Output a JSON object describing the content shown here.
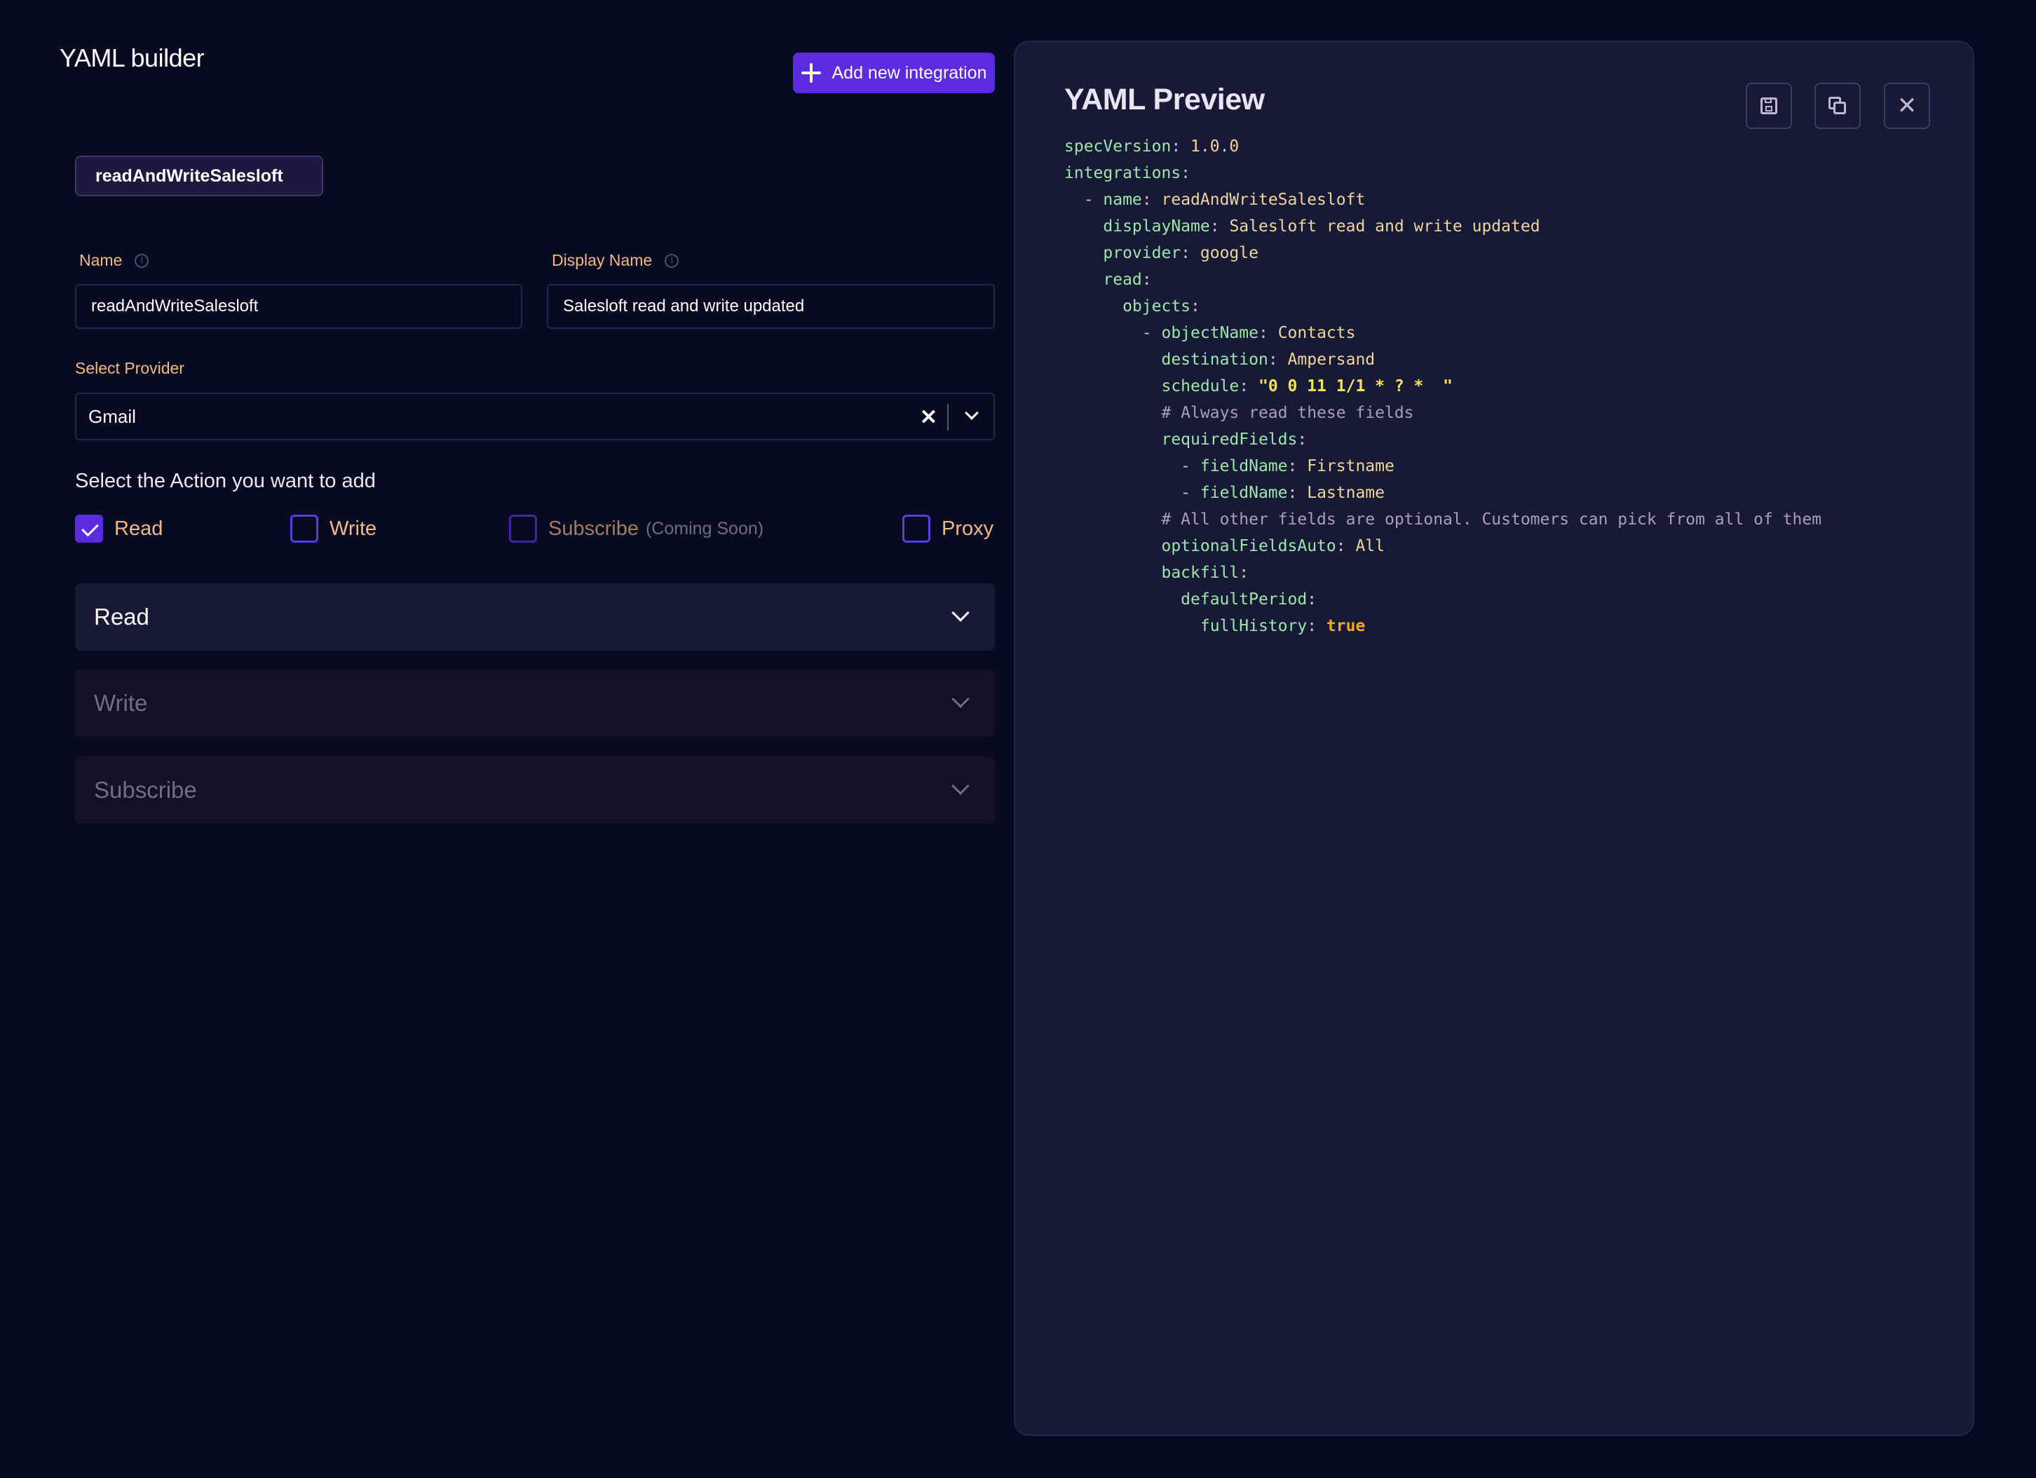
{
  "header": {
    "title": "YAML builder",
    "add_button_label": "Add new integration"
  },
  "tabs": [
    {
      "label": "readAndWriteSalesloft"
    }
  ],
  "form": {
    "name_label": "Name",
    "name_value": "readAndWriteSalesloft",
    "display_name_label": "Display Name",
    "display_name_value": "Salesloft read and write updated",
    "provider_label": "Select Provider",
    "provider_value": "Gmail",
    "action_title": "Select the Action you want to add",
    "actions": [
      {
        "label": "Read",
        "checked": true,
        "note": ""
      },
      {
        "label": "Write",
        "checked": false,
        "note": ""
      },
      {
        "label": "Subscribe",
        "checked": false,
        "note": "(Coming Soon)"
      },
      {
        "label": "Proxy",
        "checked": false,
        "note": ""
      }
    ]
  },
  "sections": [
    {
      "label": "Read",
      "enabled": true
    },
    {
      "label": "Write",
      "enabled": false
    },
    {
      "label": "Subscribe",
      "enabled": false
    }
  ],
  "preview": {
    "title": "YAML Preview",
    "buttons": [
      "save-icon",
      "copy-icon",
      "close-icon"
    ],
    "lines": [
      {
        "indent": "",
        "key": "specVersion",
        "value": "1.0.0",
        "vtype": "v"
      },
      {
        "indent": "",
        "key": "integrations",
        "value": "",
        "vtype": "v"
      },
      {
        "indent": "  - ",
        "key": "name",
        "value": "readAndWriteSalesloft",
        "vtype": "v"
      },
      {
        "indent": "    ",
        "key": "displayName",
        "value": "Salesloft read and write updated",
        "vtype": "v"
      },
      {
        "indent": "    ",
        "key": "provider",
        "value": "google",
        "vtype": "v"
      },
      {
        "indent": "    ",
        "key": "read",
        "value": "",
        "vtype": "v"
      },
      {
        "indent": "      ",
        "key": "objects",
        "value": "",
        "vtype": "v"
      },
      {
        "indent": "        - ",
        "key": "objectName",
        "value": "Contacts",
        "vtype": "v"
      },
      {
        "indent": "          ",
        "key": "destination",
        "value": "Ampersand",
        "vtype": "v"
      },
      {
        "indent": "          ",
        "key": "schedule",
        "value": "\"0 0 11 1/1 * ? *  \"",
        "vtype": "s"
      },
      {
        "indent": "          ",
        "comment": "# Always read these fields"
      },
      {
        "indent": "          ",
        "key": "requiredFields",
        "value": "",
        "vtype": "v"
      },
      {
        "indent": "            - ",
        "key": "fieldName",
        "value": "Firstname",
        "vtype": "v"
      },
      {
        "indent": "            - ",
        "key": "fieldName",
        "value": "Lastname",
        "vtype": "v"
      },
      {
        "indent": "          ",
        "comment": "# All other fields are optional. Customers can pick from all of them"
      },
      {
        "indent": "          ",
        "key": "optionalFieldsAuto",
        "value": "All",
        "vtype": "v"
      },
      {
        "indent": "          ",
        "key": "backfill",
        "value": "",
        "vtype": "v"
      },
      {
        "indent": "            ",
        "key": "defaultPeriod",
        "value": "",
        "vtype": "v"
      },
      {
        "indent": "              ",
        "key": "fullHistory",
        "value": "true",
        "vtype": "b"
      }
    ]
  },
  "colors": {
    "background": "#070b22",
    "accent": "#5b2be0",
    "label": "#f5b97e",
    "panel": "#171a36"
  }
}
